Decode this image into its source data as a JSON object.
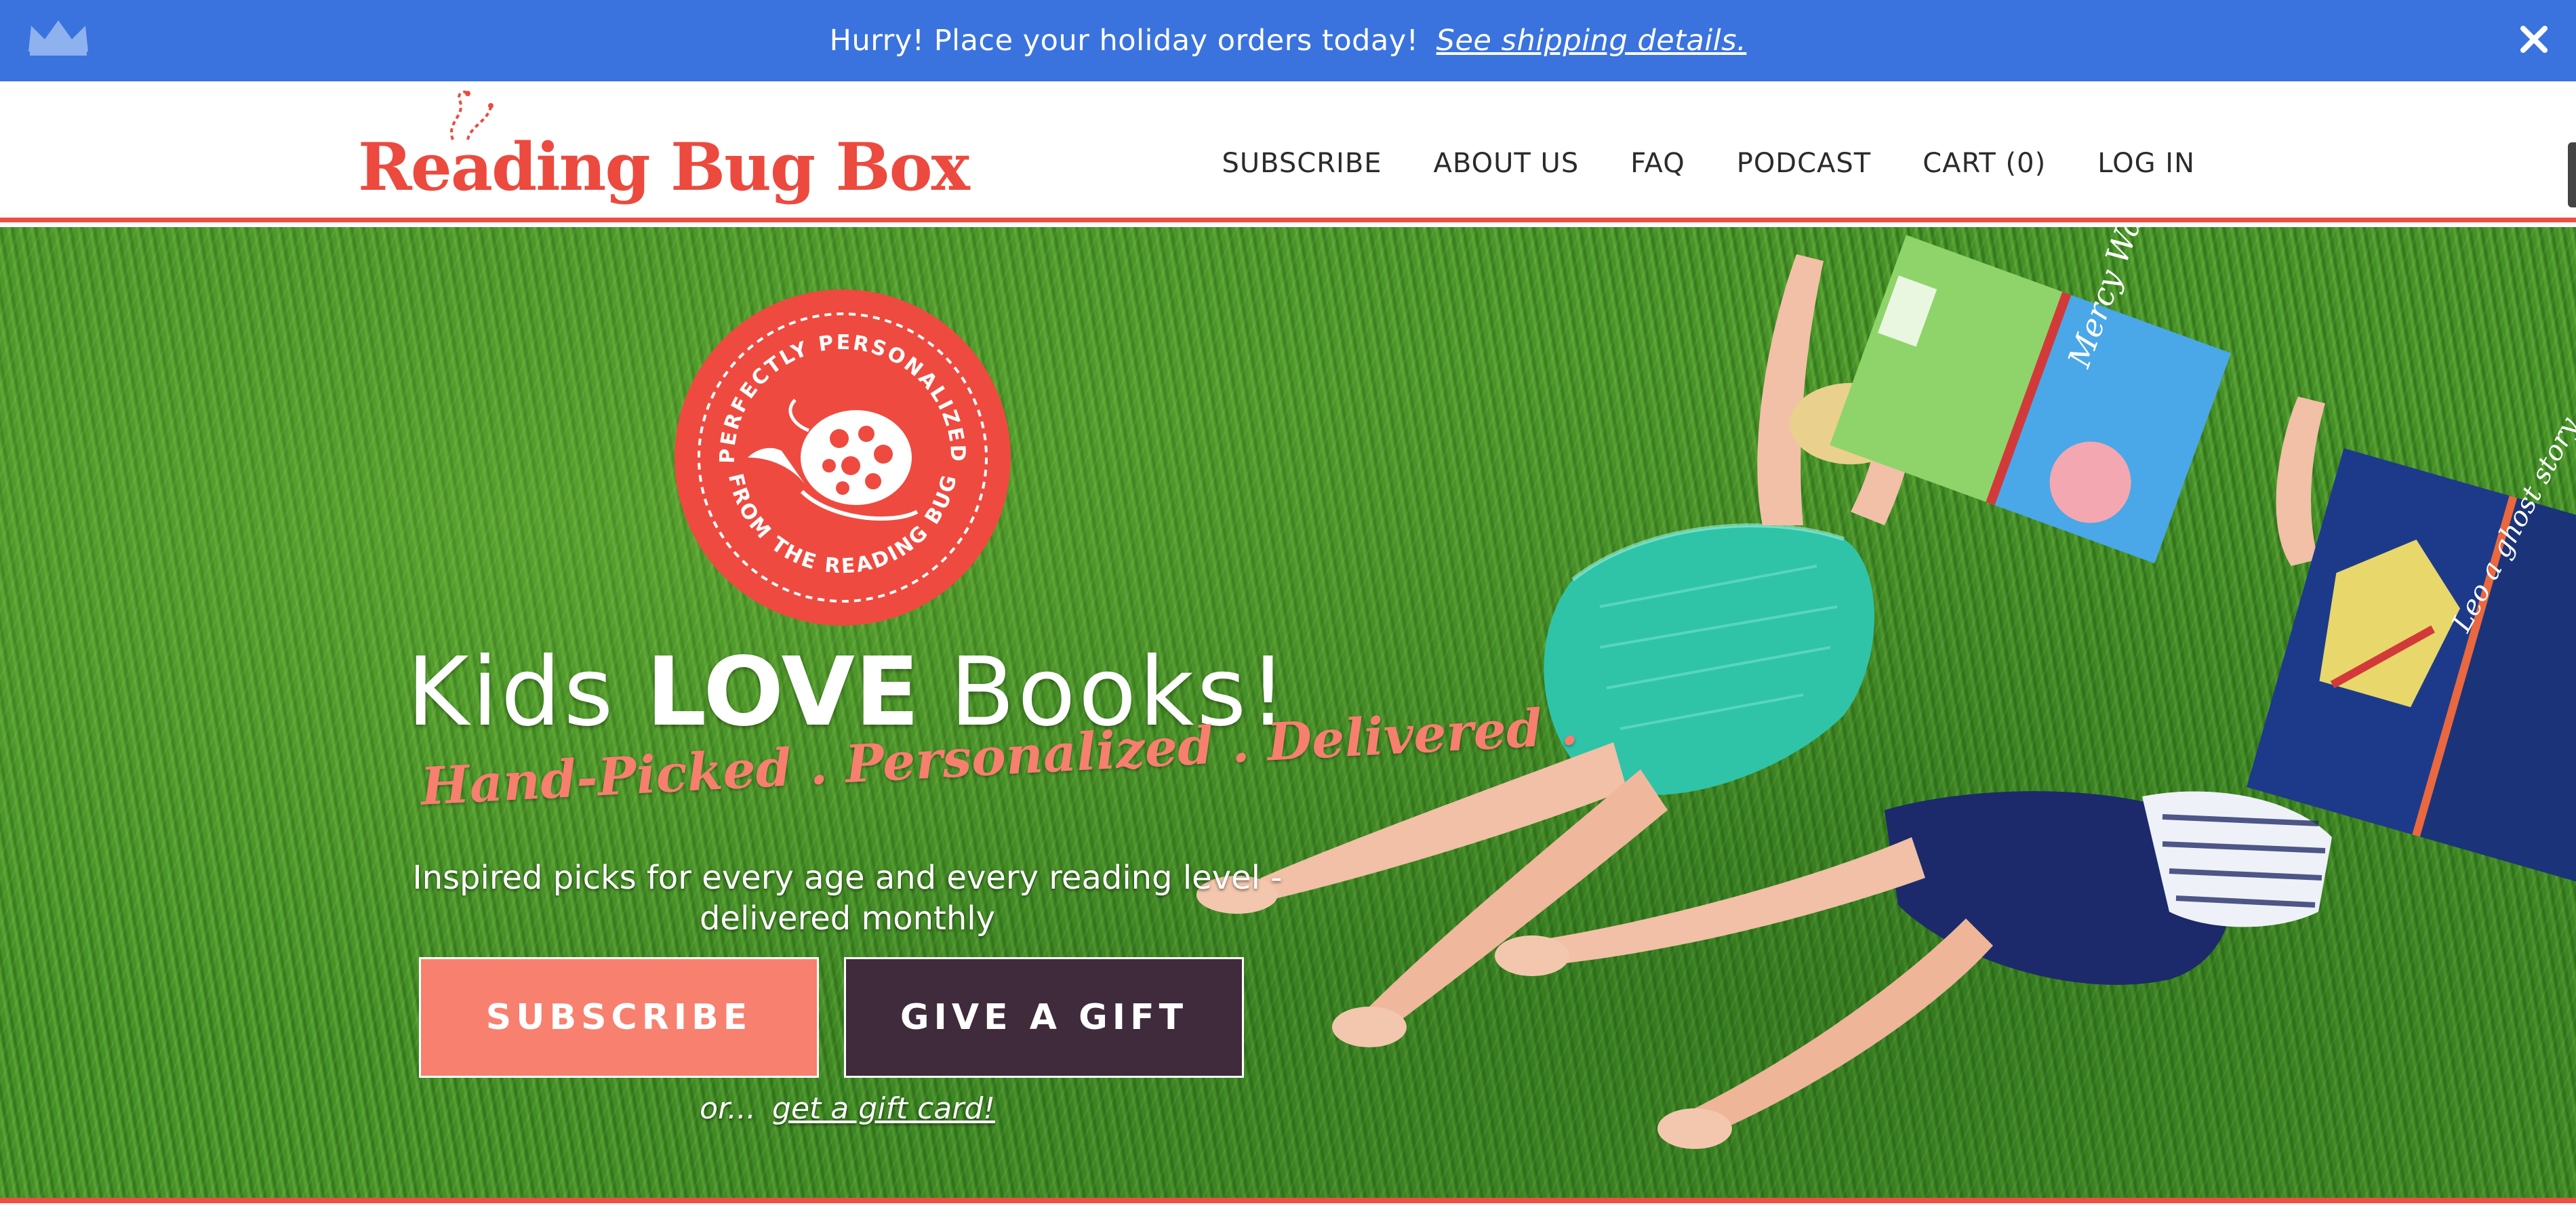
{
  "announcement": {
    "message": "Hurry! Place your holiday orders today!",
    "link": "See shipping details.",
    "background": "#3a73de"
  },
  "header": {
    "logo_text": "Reading Bug Box",
    "nav": [
      {
        "label": "SUBSCRIBE"
      },
      {
        "label": "ABOUT US"
      },
      {
        "label": "FAQ"
      },
      {
        "label": "PODCAST"
      },
      {
        "label": "CART (0)"
      },
      {
        "label": "LOG IN"
      }
    ],
    "accent": "#ef4f42"
  },
  "hero": {
    "badge": {
      "text_top": "PERFECTLY PERSONALIZED",
      "text_bottom": "FROM THE READING BUG",
      "color": "#ef4a3f"
    },
    "headline": {
      "part1": "Kids",
      "part2": "LOVE",
      "part3": "Books!"
    },
    "tagline": "Hand-Picked . Personalized . Delivered .",
    "subtext_line1": "Inspired picks for every age and every reading level -",
    "subtext_line2": "delivered monthly",
    "subscribe_button": "SUBSCRIBE",
    "gift_button": "GIVE A GIFT",
    "giftcard_prefix": "or...",
    "giftcard_link": "get a gift card!",
    "book1_title": "Mercy Watson",
    "book2_title": "Leo a ghost story",
    "colors": {
      "subscribe_bg": "#f8806f",
      "gift_bg": "#3f2b3b",
      "tagline": "#f77f6e"
    }
  },
  "icons": {
    "crown": "crown-icon",
    "close": "close-icon"
  }
}
